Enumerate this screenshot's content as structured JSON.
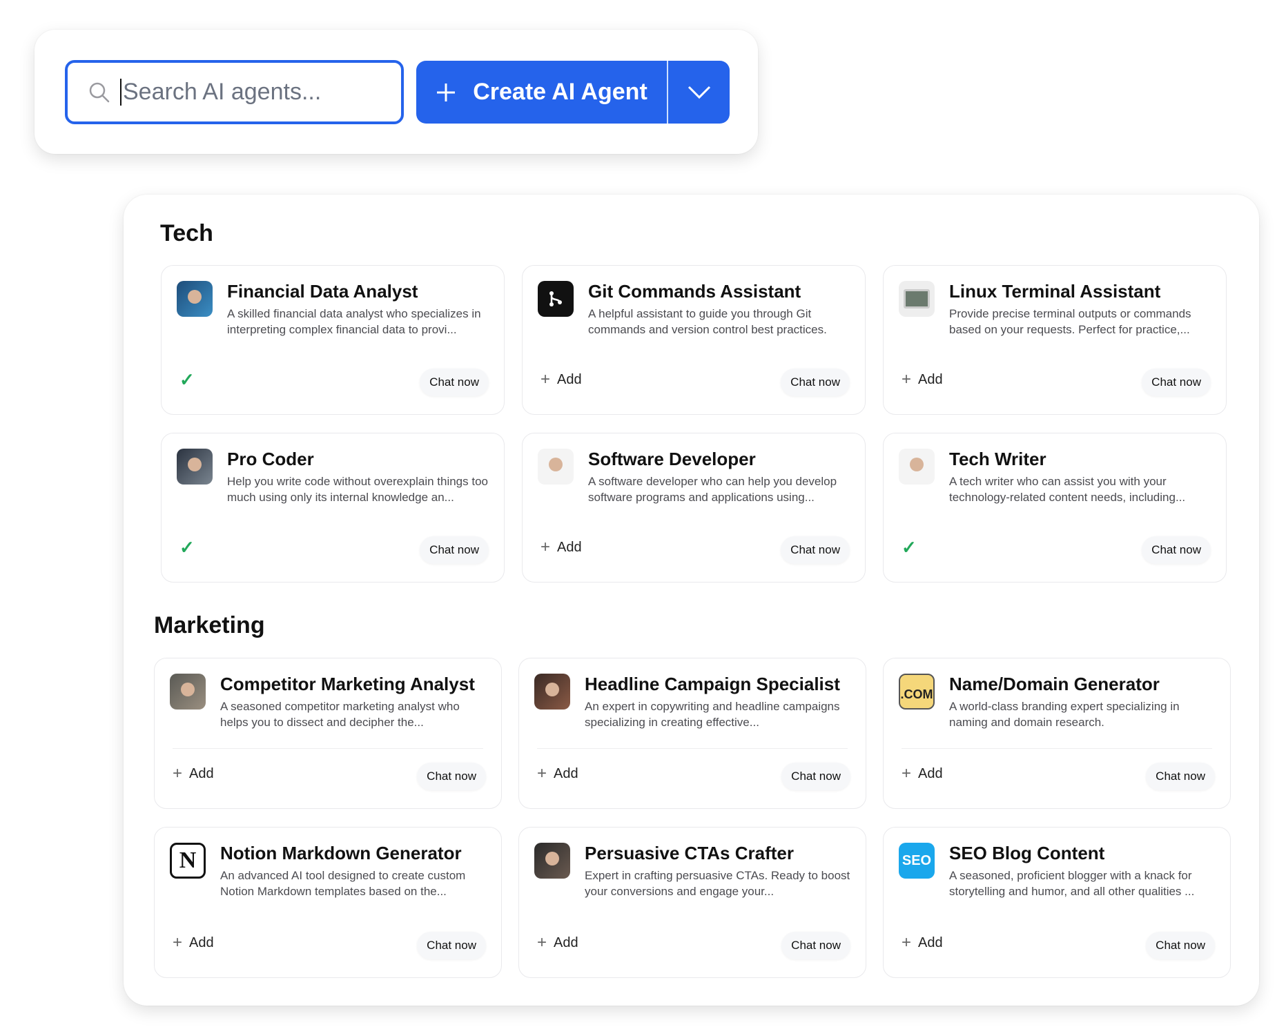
{
  "toolbar": {
    "search_placeholder": "Search AI agents...",
    "search_icon": "search-icon",
    "create_label": "Create AI Agent",
    "create_icon": "plus-icon",
    "dropdown_icon": "chevron-down-icon",
    "accent_color": "#2563eb"
  },
  "labels": {
    "add": "Add",
    "chat_now": "Chat now"
  },
  "sections": [
    {
      "title": "Tech",
      "agents": [
        {
          "title": "Financial Data Analyst",
          "desc": "A skilled financial data analyst who specializes in interpreting complex financial data to provi...",
          "added": true,
          "avatar": "photo-analyst"
        },
        {
          "title": "Git Commands Assistant",
          "desc": "A helpful assistant to guide you through Git commands and version control best practices.",
          "added": false,
          "avatar": "git"
        },
        {
          "title": "Linux Terminal Assistant",
          "desc": "Provide precise terminal outputs or commands based on your requests. Perfect for practice,...",
          "added": false,
          "avatar": "terminal"
        },
        {
          "title": "Pro Coder",
          "desc": "Help you write code without overexplain things too much using only its internal knowledge an...",
          "added": true,
          "avatar": "photo-robot"
        },
        {
          "title": "Software Developer",
          "desc": "A software developer who can help you develop software programs and applications using...",
          "added": false,
          "avatar": "photo-man-beard"
        },
        {
          "title": "Tech Writer",
          "desc": "A tech writer who can assist you with your technology-related content needs, including...",
          "added": true,
          "avatar": "photo-man-standing"
        }
      ]
    },
    {
      "title": "Marketing",
      "agents": [
        {
          "title": "Competitor Marketing Analyst",
          "desc": "A seasoned competitor marketing analyst who helps you to dissect and decipher the...",
          "added": false,
          "avatar": "photo-man",
          "divider": true
        },
        {
          "title": "Headline Campaign Specialist",
          "desc": "An expert in copywriting and headline campaigns specializing in creating effective...",
          "added": false,
          "avatar": "photo-woman",
          "divider": true
        },
        {
          "title": "Name/Domain Generator",
          "desc": "A world-class branding expert specializing in naming and domain research.",
          "added": false,
          "avatar": "dotcom",
          "avatar_text": ".COM",
          "divider": true
        },
        {
          "title": "Notion Markdown Generator",
          "desc": "An advanced AI tool designed to create custom Notion Markdown templates based on the...",
          "added": false,
          "avatar": "notion",
          "avatar_text": "N"
        },
        {
          "title": "Persuasive CTAs Crafter",
          "desc": "Expert in crafting persuasive CTAs. Ready to boost your conversions and engage your...",
          "added": false,
          "avatar": "photo-woman2"
        },
        {
          "title": "SEO Blog Content",
          "desc": "A seasoned, proficient blogger with a knack for storytelling and humor, and all other qualities ...",
          "added": false,
          "avatar": "seo",
          "avatar_text": "SEO"
        }
      ]
    }
  ],
  "colors": {
    "added_check": "#22a85a",
    "seo_bg": "#1aa7ec",
    "dotcom_bg": "#f5d77a"
  }
}
